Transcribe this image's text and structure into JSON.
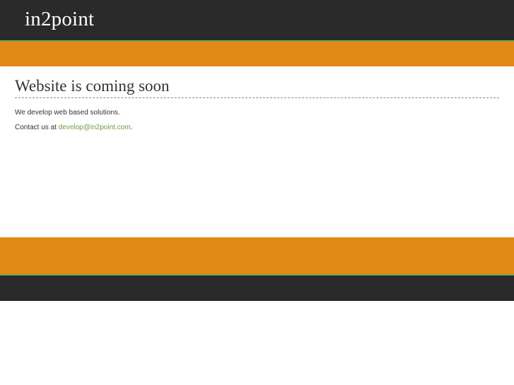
{
  "header": {
    "logo_text": "in2point"
  },
  "main": {
    "headline": "Website is coming soon",
    "tagline": "We develop web based solutions.",
    "contact_prefix": "Contact us at ",
    "contact_email": "develop@in2point.com",
    "contact_suffix": "."
  },
  "colors": {
    "dark_bar": "#2a2a2a",
    "orange_band": "#e08a15",
    "accent_green": "#7aa64a",
    "link_green": "#6f9a45"
  }
}
